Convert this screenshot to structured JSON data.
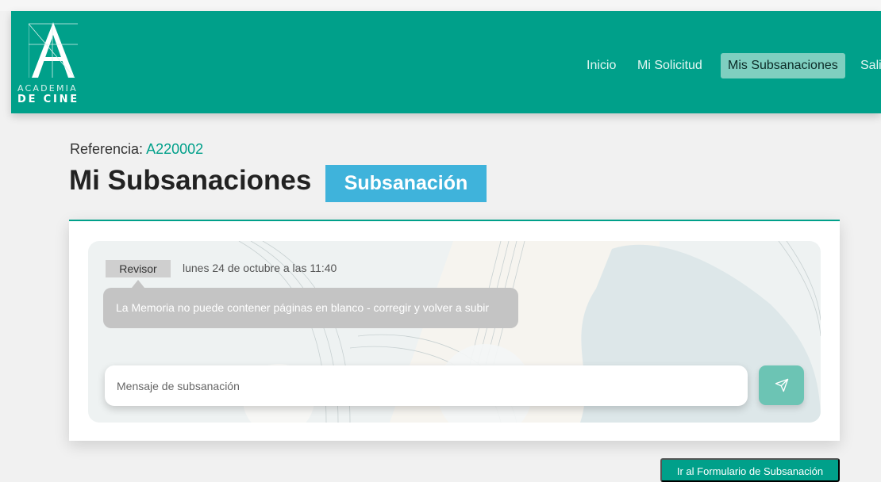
{
  "brand": {
    "logo_letter": "A",
    "logo_line1": "ACADEMIA",
    "logo_line2": "DE CINE"
  },
  "nav": {
    "items": [
      {
        "label": "Inicio",
        "active": false
      },
      {
        "label": "Mi Solicitud",
        "active": false
      },
      {
        "label": "Mis Subsanaciones",
        "active": true
      },
      {
        "label": "Sali",
        "active": false
      }
    ]
  },
  "reference": {
    "label": "Referencia:",
    "value": "A220002"
  },
  "page": {
    "title": "Mi Subsanaciones",
    "badge": "Subsanación"
  },
  "chat": {
    "messages": [
      {
        "author": "Revisor",
        "time": "lunes 24 de octubre a las 11:40",
        "text": "La Memoria no puede contener páginas en blanco - corregir y volver a subir"
      }
    ],
    "input_placeholder": "Mensaje de subsanación",
    "send_icon": "send-icon"
  },
  "actions": {
    "form_button": "Ir al Formulario de Subsanación"
  },
  "colors": {
    "primary": "#00a08a",
    "badge_blue": "#3fb3db",
    "bubble_gray": "#c4c4c4",
    "send_button": "#6cc4b4"
  }
}
